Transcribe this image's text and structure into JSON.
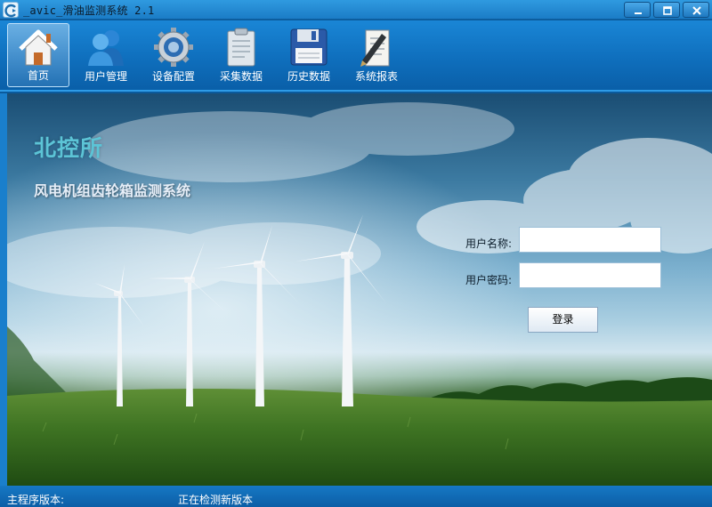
{
  "window": {
    "title": "_avic_滑油监测系统 2.1",
    "icon": "app-icon"
  },
  "toolbar": {
    "items": [
      {
        "label": "首页",
        "icon": "home-icon",
        "active": true
      },
      {
        "label": "用户管理",
        "icon": "users-icon",
        "active": false
      },
      {
        "label": "设备配置",
        "icon": "gear-icon",
        "active": false
      },
      {
        "label": "采集数据",
        "icon": "clipboard-icon",
        "active": false
      },
      {
        "label": "历史数据",
        "icon": "floppy-disk-icon",
        "active": false
      },
      {
        "label": "系统报表",
        "icon": "report-pen-icon",
        "active": false
      }
    ]
  },
  "banner": {
    "org_name": "北控所",
    "system_name": "风电机组齿轮箱监测系统"
  },
  "login": {
    "username_label": "用户名称:",
    "password_label": "用户密码:",
    "username_value": "",
    "password_value": "",
    "submit_label": "登录"
  },
  "status": {
    "version_label": "主程序版本:",
    "version_value": "",
    "update_text": "正在检测新版本"
  },
  "colors": {
    "titlebar": "#2f9ae0",
    "toolbar": "#1a86d6",
    "org_name": "#5cc4d6",
    "statusbar": "#1678c4"
  }
}
